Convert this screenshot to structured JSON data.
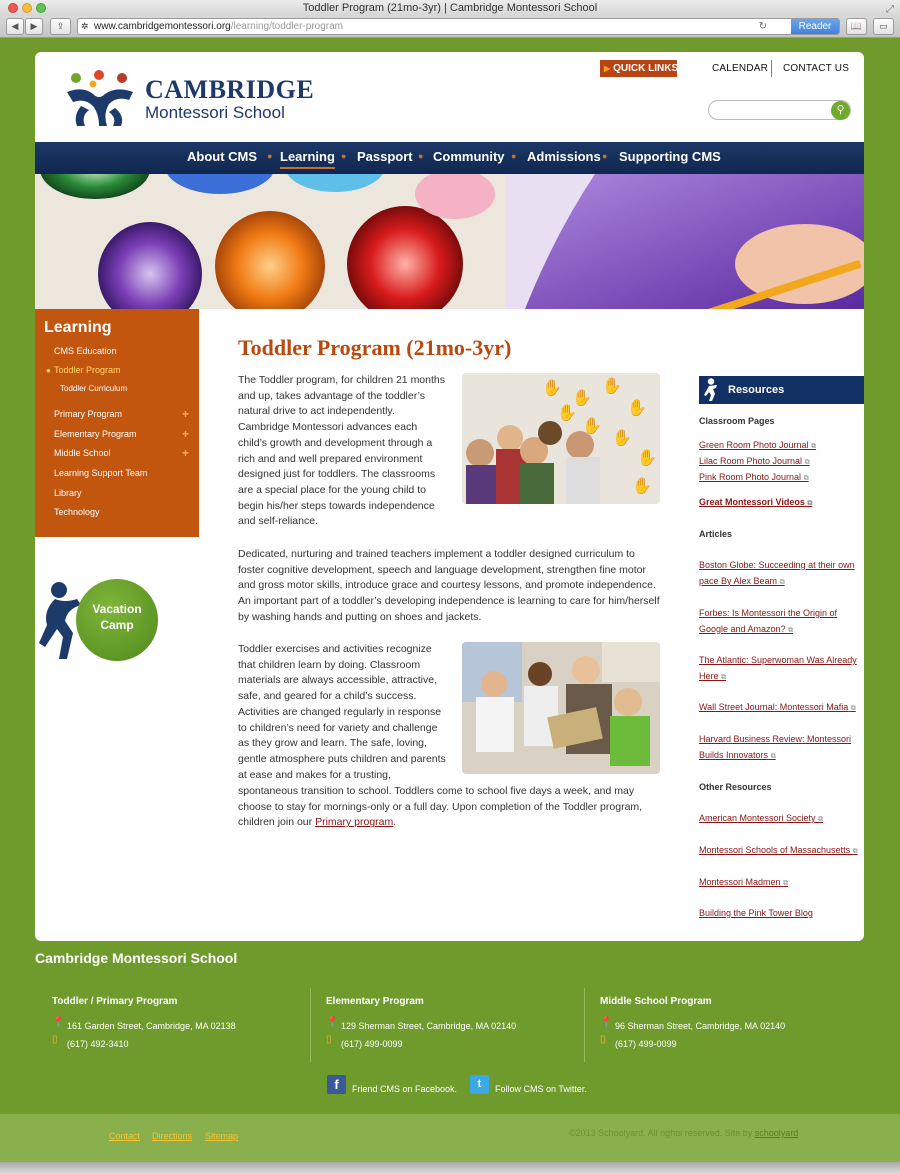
{
  "browser": {
    "window_title": "Toddler Program (21mo-3yr) | Cambridge Montessori School",
    "url_domain": "www.cambridgemontessori.org",
    "url_path": "/learning/toddler-program",
    "reader_label": "Reader"
  },
  "header": {
    "logo_line1": "CAMBRIDGE",
    "logo_line2": "Montessori School",
    "quick_links": "QUICK LINKS",
    "calendar": "CALENDAR",
    "contact": "CONTACT US",
    "search_placeholder": ""
  },
  "nav": {
    "items": [
      "About CMS",
      "Learning",
      "Passport",
      "Community",
      "Admissions",
      "Supporting CMS"
    ],
    "active": "Learning"
  },
  "sidebar": {
    "title": "Learning",
    "items": [
      {
        "label": "CMS Education"
      },
      {
        "label": "Toddler Program"
      },
      {
        "label": "Toddler Curriculum"
      },
      {
        "label": "Primary Program"
      },
      {
        "label": "Elementary Program"
      },
      {
        "label": "Middle School"
      },
      {
        "label": "Learning Support Team"
      },
      {
        "label": "Library"
      },
      {
        "label": "Technology"
      }
    ],
    "vacation_line1": "Vacation",
    "vacation_line2": "Camp"
  },
  "main": {
    "title": "Toddler Program (21mo-3yr)",
    "para1": "The Toddler program, for children 21 months and up, takes advantage of the toddler’s natural drive to act independently. Cambridge Montessori advances each child’s growth and development through a rich and and well prepared environment designed just for toddlers. The classrooms are a special place for the young child to begin his/her steps towards independence and self-reliance.",
    "para2": "Dedicated, nurturing and trained teachers implement a toddler designed curriculum to foster cognitive development, speech and language development, strengthen fine motor and gross motor skills, introduce grace and courtesy lessons, and promote independence. An important part of a toddler’s developing independence is learning to care for him/herself by washing hands and putting on shoes and jackets.",
    "para3_short": "Toddler exercises and activities recognize that children learn by doing. Classroom materials are always accessible, attractive, safe, and geared for a child’s success. Activities are changed regularly in response to children’s need for variety and challenge as they grow and learn. The safe, loving, gentle atmosphere puts children and parents at ease and makes for a trusting,",
    "para3_wide": "spontaneous transition to school. Toddlers come to school five days a week, and may choose to stay for mornings-only or a full day. Upon completion of the Toddler program, children join our",
    "primary_link": "Primary program",
    "period": "."
  },
  "resources": {
    "title": "Resources",
    "classroom_head": "Classroom Pages",
    "classroom_links": [
      "Green Room Photo Journal",
      "Lilac Room Photo Journal",
      "Pink Room Photo Journal"
    ],
    "videos_link": "Great Montessori Videos",
    "articles_head": "Articles",
    "articles": [
      "Boston Globe: Succeeding at their own pace By Alex Beam",
      "Forbes: Is Montessori the Origin of Google and Amazon?",
      "The Atlantic: Superwoman Was Already Here",
      "Wall Street Journal: Montessori Mafia",
      "Harvard Business Review: Montessori Builds Innovators"
    ],
    "other_head": "Other Resources",
    "other": [
      "American Montessori Society",
      "Montessori Schools of Massachusetts",
      "Montessori Madmen",
      "Building the Pink Tower Blog"
    ]
  },
  "footer": {
    "school_name": "Cambridge Montessori School",
    "columns": [
      {
        "title": "Toddler / Primary Program",
        "address": "161 Garden Street, Cambridge, MA 02138",
        "phone": "(617) 492-3410"
      },
      {
        "title": "Elementary Program",
        "address": "129 Sherman Street, Cambridge, MA 02140",
        "phone": "(617) 499-0099"
      },
      {
        "title": "Middle School Program",
        "address": "96 Sherman Street, Cambridge, MA 02140",
        "phone": "(617) 499-0099"
      }
    ],
    "facebook": "Friend CMS on Facebook.",
    "twitter": "Follow CMS on Twitter.",
    "links": [
      "Contact",
      "Directions",
      "Sitemap"
    ],
    "copyright": "©2013 Schoolyard. All rights reserved. Site by",
    "schoolyard": "schoolyard"
  },
  "colors": {
    "background": "#6f9a2c",
    "navy": "#123064",
    "orange": "#c3560f",
    "title_rust": "#b9490f",
    "link_red": "#8b1414"
  }
}
